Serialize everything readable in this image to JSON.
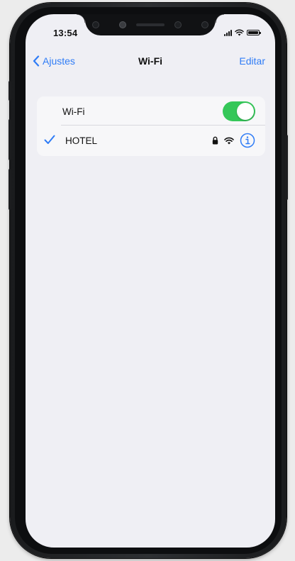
{
  "status_bar": {
    "time": "13:54"
  },
  "nav": {
    "back_label": "Ajustes",
    "title": "Wi-Fi",
    "edit_label": "Editar"
  },
  "wifi_row": {
    "label": "Wi-Fi",
    "toggle_on": true
  },
  "network_row": {
    "name": "HOTEL",
    "connected": true,
    "icons": [
      "checkmark-icon",
      "lock-icon",
      "wifi-signal-icon",
      "info-icon"
    ]
  },
  "colors": {
    "accent": "#2f7cf6",
    "toggle_on": "#35c759",
    "background": "#efeff4",
    "group_background": "#f7f7f9",
    "phone_frame": "#1a1b1d"
  }
}
